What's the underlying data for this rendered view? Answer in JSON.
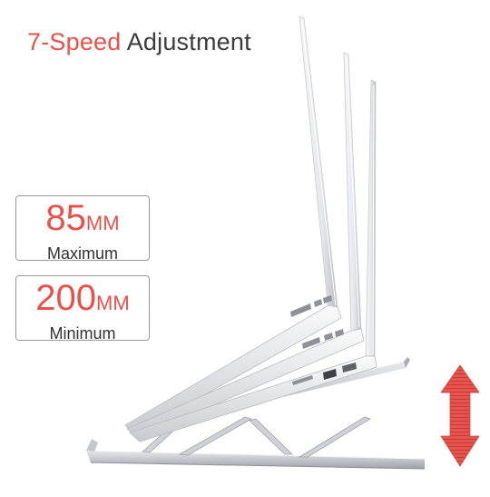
{
  "headline": {
    "accent": "7-Speed",
    "rest": "Adjustment"
  },
  "specs": [
    {
      "value": "85",
      "unit": "MM",
      "label": "Maximum"
    },
    {
      "value": "200",
      "unit": "MM",
      "label": "Minimum"
    }
  ],
  "colors": {
    "accent": "#e9524a",
    "text": "#3b3b3b",
    "arrow": "#e5554d",
    "stand": "#c9ccd1"
  },
  "icons": {
    "height-arrow": "double-headed-vertical-arrow"
  }
}
